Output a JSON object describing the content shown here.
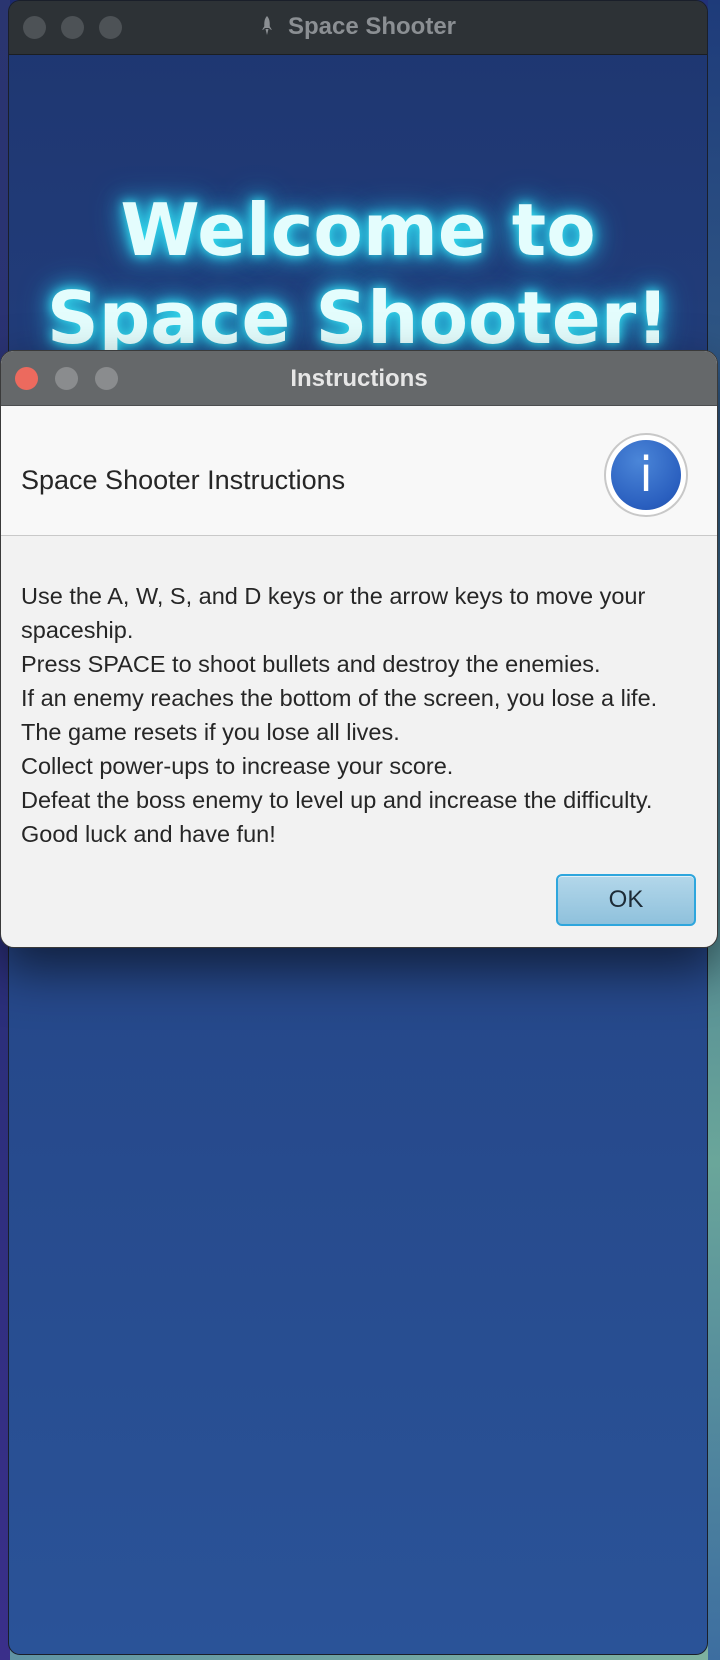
{
  "main_window": {
    "title": "Space Shooter",
    "title_icon": "rocket-icon",
    "welcome_line1": "Welcome to",
    "welcome_line2": "Space Shooter!"
  },
  "dialog": {
    "title": "Instructions",
    "heading": "Space Shooter Instructions",
    "icon": "info-icon",
    "icon_glyph": "i",
    "lines": [
      "Use the A, W, S, and D keys or the arrow keys to move your",
      "spaceship.",
      "Press SPACE to shoot bullets and destroy the enemies.",
      "If an enemy reaches the bottom of the screen, you lose a life.",
      "The game resets if you lose all lives.",
      "Collect power-ups to increase your score.",
      "Defeat the boss enemy to level up and increase the difficulty.",
      "Good luck and have fun!"
    ],
    "ok_label": "OK"
  },
  "colors": {
    "close_red": "#ec6a5e",
    "inactive_gray": "#8a8c8e",
    "accent_blue": "#2ea6dd",
    "glow_cyan": "#36e0f0"
  }
}
